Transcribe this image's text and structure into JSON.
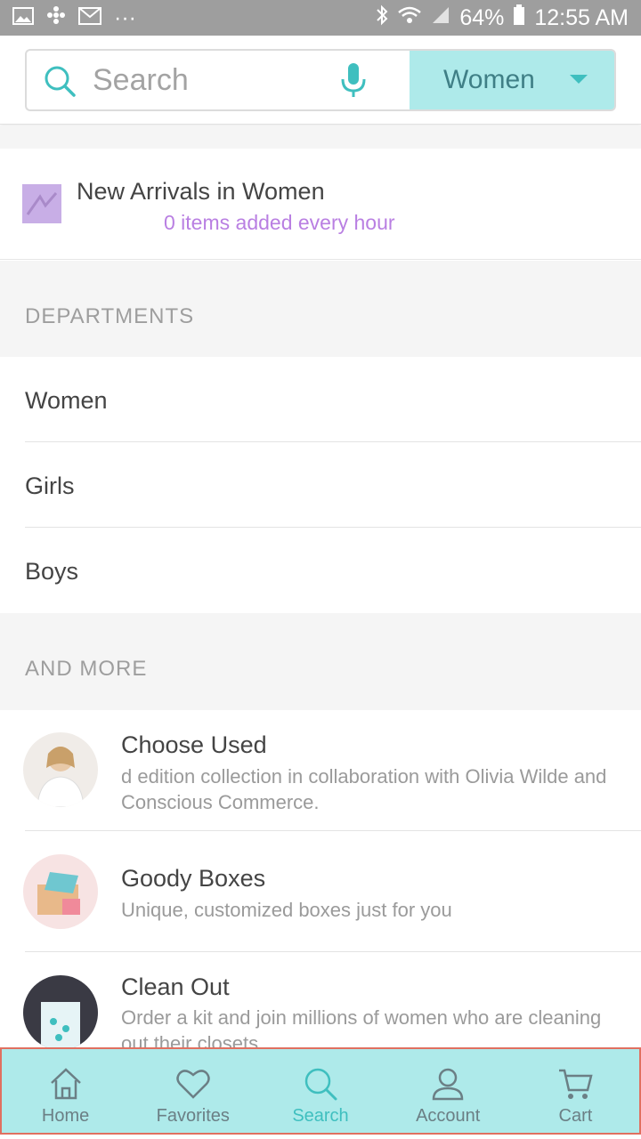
{
  "status_bar": {
    "battery": "64%",
    "time": "12:55 AM",
    "more": "···"
  },
  "search": {
    "placeholder": "Search",
    "department_selected": "Women"
  },
  "new_arrivals": {
    "title": "New Arrivals in Women",
    "subtitle": "0 items added every hour"
  },
  "departments": {
    "header": "DEPARTMENTS",
    "items": [
      {
        "label": "Women"
      },
      {
        "label": "Girls"
      },
      {
        "label": "Boys"
      }
    ]
  },
  "and_more": {
    "header": "AND MORE",
    "items": [
      {
        "title": "Choose Used",
        "description": "d edition collection in collaboration with Olivia Wilde and Conscious Commerce."
      },
      {
        "title": "Goody Boxes",
        "description": "Unique, customized boxes just for you"
      },
      {
        "title": "Clean Out",
        "description": "Order a kit and join millions of women who are cleaning out their closets"
      }
    ]
  },
  "bottom_nav": {
    "items": [
      {
        "label": "Home",
        "icon": "home-icon"
      },
      {
        "label": "Favorites",
        "icon": "heart-icon"
      },
      {
        "label": "Search",
        "icon": "search-icon",
        "active": true
      },
      {
        "label": "Account",
        "icon": "account-icon"
      },
      {
        "label": "Cart",
        "icon": "cart-icon"
      }
    ]
  },
  "colors": {
    "accent": "#3fbfbf",
    "accent_bg": "#aeeaea",
    "status_bar": "#9e9e9e"
  }
}
